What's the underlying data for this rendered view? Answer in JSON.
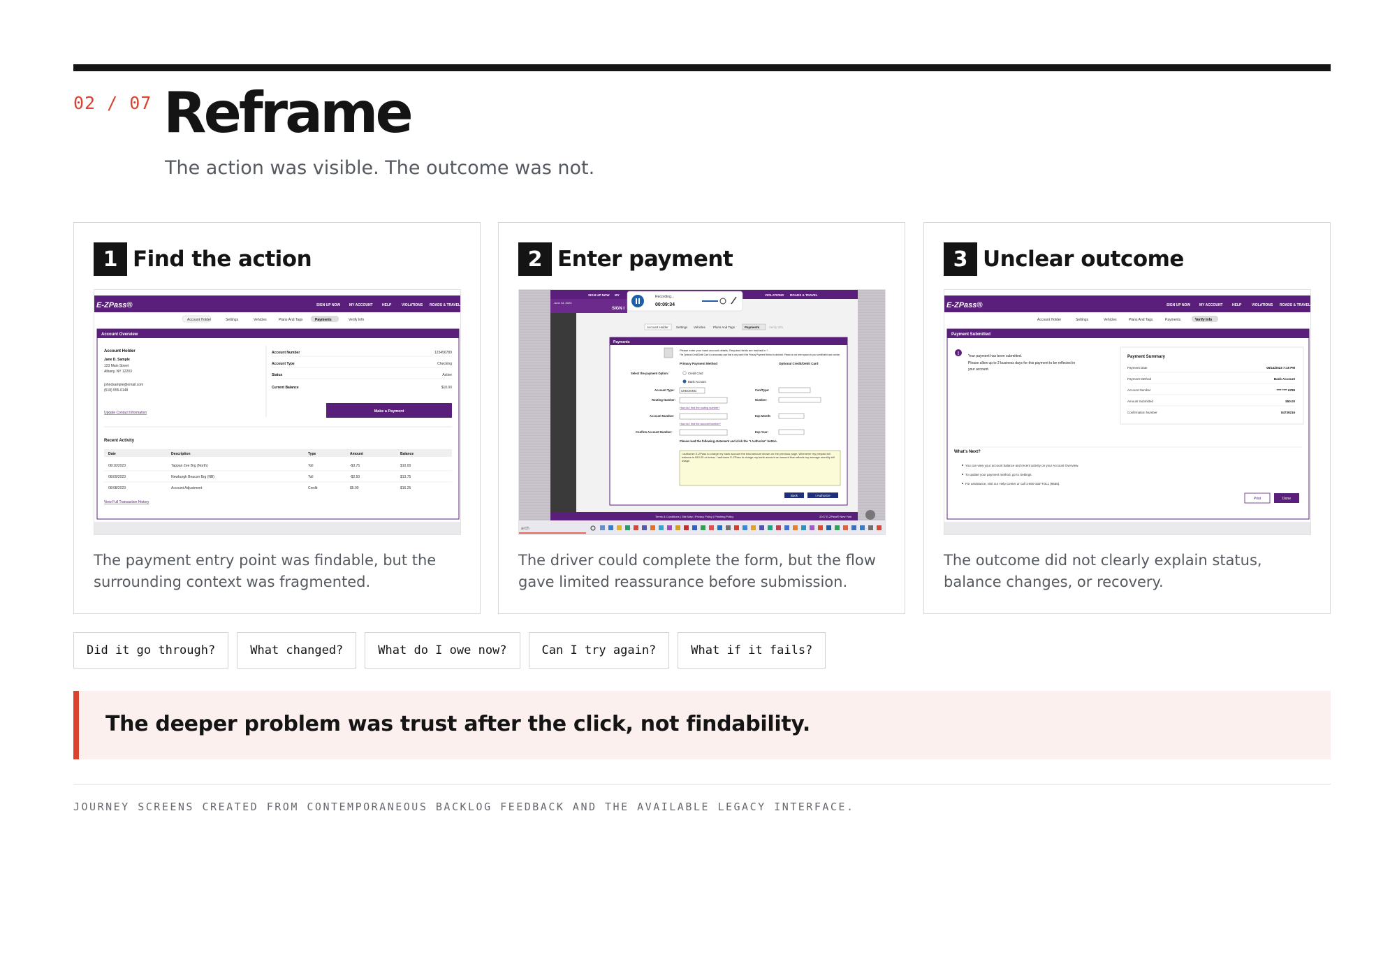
{
  "header": {
    "section_number": "02 / 07",
    "title": "Reframe",
    "subtitle": "The action was visible. The outcome was not."
  },
  "cards": [
    {
      "step": "1",
      "title": "Find the action",
      "description": "The payment entry point was findable, but the surrounding context was fragmented.",
      "screenshot": {
        "brand": "E-ZPass®",
        "nav": [
          "SIGN UP NOW",
          "MY ACCOUNT",
          "HELP",
          "VIOLATIONS",
          "ROADS & TRAVEL"
        ],
        "tabs": [
          "Account Holder",
          "Settings",
          "Vehicles",
          "Plans And Tags",
          "Payments",
          "Verify Info"
        ],
        "active_tab": "Payments",
        "panel_title": "Account Overview",
        "account_holder_label": "Account Holder",
        "holder_name": "Jane D. Sample",
        "address_line1": "123 Main Street",
        "address_line2": "Albany, NY 12203",
        "email": "johndsample@email.com",
        "phone": "(518) 555-0148",
        "update_link": "Update Contact Information",
        "fields": [
          {
            "label": "Account Number",
            "value": "123456789"
          },
          {
            "label": "Account Type",
            "value": "Checking"
          },
          {
            "label": "Status",
            "value": "Active"
          },
          {
            "label": "Current Balance",
            "value": "$10.00"
          }
        ],
        "cta": "Make a Payment",
        "recent_title": "Recent Activity",
        "table_headers": [
          "Date",
          "Description",
          "Type",
          "Amount",
          "Balance"
        ],
        "rows": [
          [
            "06/10/2023",
            "Tappan Zee Brg (North)",
            "Toll",
            "-$3.75",
            "$10.00"
          ],
          [
            "06/09/2023",
            "Newburgh Beacon Brg (NB)",
            "Toll",
            "-$2.50",
            "$13.75"
          ],
          [
            "06/08/2023",
            "Account Adjustment",
            "Credit",
            "$5.00",
            "$16.25"
          ]
        ],
        "history_link": "View Full Transaction History"
      }
    },
    {
      "step": "2",
      "title": "Enter payment",
      "description": "The driver could complete the form, but the flow gave limited reassurance before submission.",
      "screenshot": {
        "nav": [
          "SIGN UP NOW",
          "MY",
          "VIOLATIONS",
          "ROADS & TRAVEL"
        ],
        "date_text": "June 14, 2023",
        "sign_text": "SIGN I",
        "recording_label": "Recording...",
        "recording_time": "00:09:34",
        "tabs": [
          "Account Holder",
          "Settings",
          "Vehicles",
          "Plans And Tags",
          "Payments",
          "Verify Info"
        ],
        "active_tab": "Payments",
        "panel_title": "Payments",
        "intro_text": "Please enter your bank account details. Required fields are marked in *.",
        "intro_text_2": "The Optional Credit/Debit Card is a secondary card that is only used if the Primary Payment Method is declined. Please do not enter spaces in your credit/debit card number.",
        "primary_label": "Primary Payment Method",
        "optional_label": "Optional Credit/Debit Card",
        "select_label": "Select the payment Option:",
        "option_credit": "Credit Card",
        "option_bank": "Bank Account",
        "account_type_label": "Account Type:",
        "account_type_value": "CHECKING",
        "routing_label": "Routing Number:",
        "routing_help": "How do I find the routing number?",
        "account_label": "Account Number:",
        "account_help": "How do I find the account number?",
        "confirm_label": "Confirm Account Number:",
        "card_type_label": "CardType:",
        "number_label": "Number:",
        "exp_month_label": "Exp Month:",
        "exp_year_label": "Exp Year:",
        "statement_label": "Please read the following statement and click the \"I Authorize\" button.",
        "authorize_text": "I authorize E-ZPass to charge my bank account the total amount shown on the previous page. Whenever my prepaid toll balance is $10.00 or below, I authorize E-ZPass to charge my bank account an amount that reflects my average monthly toll usage.",
        "back_button": "Back",
        "authorize_button": "I Authorize",
        "footer_links": "Terms & Conditions  |  Site Map  |  Privacy Policy  |  Phishing Policy",
        "footer_copy": "2017 E-ZPass® New York",
        "search_text": "arch"
      }
    },
    {
      "step": "3",
      "title": "Unclear outcome",
      "description": "The outcome did not clearly explain status, balance changes, or recovery.",
      "screenshot": {
        "brand": "E-ZPass®",
        "nav": [
          "SIGN UP NOW",
          "MY ACCOUNT",
          "HELP",
          "VIOLATIONS",
          "ROADS & TRAVEL"
        ],
        "tabs": [
          "Account Holder",
          "Settings",
          "Vehicles",
          "Plans And Tags",
          "Payments",
          "Verify Info"
        ],
        "active_tab": "Verify Info",
        "panel_title": "Payment Submitted",
        "message_line1": "Your payment has been submitted.",
        "message_line2": "Please allow up to 2 business days for this payment to be reflected in",
        "message_line3": "your account.",
        "summary_title": "Payment Summary",
        "summary": [
          {
            "label": "Payment Date",
            "value": "06/14/2023 7:15 PM"
          },
          {
            "label": "Payment Method",
            "value": "Bank Account"
          },
          {
            "label": "Account Number",
            "value": "**** **** 6789"
          },
          {
            "label": "Amount Submitted",
            "value": "$50.00"
          },
          {
            "label": "Confirmation Number",
            "value": "84739216"
          }
        ],
        "next_title": "What's Next?",
        "next_items": [
          "You can view your account balance and recent activity on your Account Overview.",
          "To update your payment method, go to Settings.",
          "For assistance, visit our Help Center or call 1-800-333-TOLL (8655)."
        ],
        "print_button": "Print",
        "done_button": "Done"
      }
    }
  ],
  "questions": [
    "Did it go through?",
    "What changed?",
    "What do I owe now?",
    "Can I try again?",
    "What if it fails?"
  ],
  "callout": "The deeper problem was trust after the click, not findability.",
  "footnote": "Journey screens created from contemporaneous backlog feedback and the available legacy interface.",
  "colors": {
    "accent": "#d9432f",
    "ink": "#141414",
    "muted": "#555a60",
    "brand_purple": "#5a1f7a",
    "callout_bg": "#fbf0ee"
  }
}
